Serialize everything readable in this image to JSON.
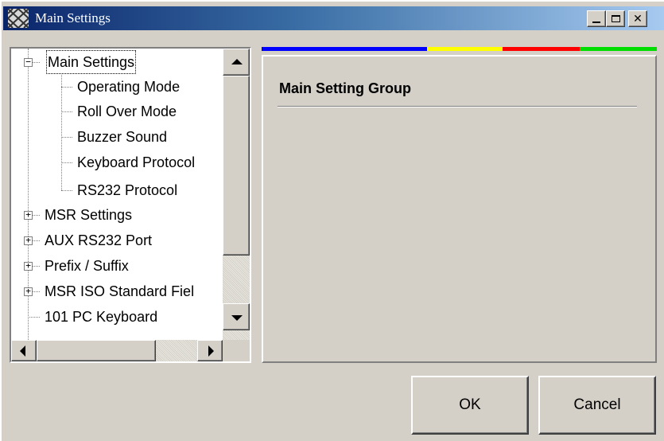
{
  "window": {
    "title": "Main Settings",
    "icon": "app-logo-icon",
    "controls": {
      "minimize": "minimize-icon",
      "maximize": "maximize-icon",
      "close": "close-icon",
      "close_glyph": "✕"
    }
  },
  "tree": {
    "items": [
      {
        "label": "Main Settings",
        "expander": "−",
        "selected": true
      },
      {
        "label": "Operating Mode"
      },
      {
        "label": "Roll Over Mode"
      },
      {
        "label": "Buzzer Sound"
      },
      {
        "label": "Keyboard Protocol"
      },
      {
        "label": "RS232 Protocol"
      },
      {
        "label": "MSR Settings",
        "expander": "+"
      },
      {
        "label": "AUX RS232 Port",
        "expander": "+"
      },
      {
        "label": "Prefix / Suffix",
        "expander": "+"
      },
      {
        "label": "MSR ISO Standard Fiel",
        "expander": "+"
      },
      {
        "label": "101 PC Keyboard"
      }
    ]
  },
  "color_bar": {
    "colors": [
      "#0000ff",
      "#ffff00",
      "#ff0000",
      "#00dd00"
    ]
  },
  "content": {
    "group_title": "Main Setting Group"
  },
  "buttons": {
    "ok_label": "OK",
    "cancel_label": "Cancel"
  }
}
